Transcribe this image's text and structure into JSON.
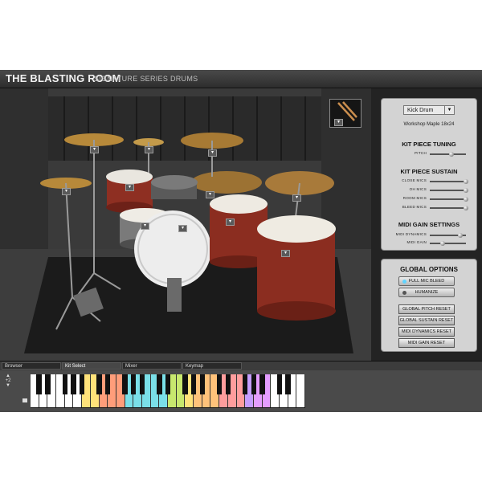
{
  "app": {
    "brand": "THE BLASTING ROOM",
    "subtitle": "SIGNATURE SERIES DRUMS"
  },
  "stage": {
    "thumbnail_icon": "drumsticks-icon",
    "drum_buttons_icon": "dropdown-arrow-icon"
  },
  "kit_piece": {
    "selected": "Kick Drum",
    "name": "Workshop Maple 18x24"
  },
  "sections": {
    "tuning_title": "KIT PIECE TUNING",
    "pitch_label": "PITCH",
    "pitch_level": 0.6,
    "sustain_title": "KIT PIECE SUSTAIN",
    "sustain_rows": [
      {
        "label": "CLOSE MICS",
        "level": 1.0
      },
      {
        "label": "OH MICS",
        "level": 1.0
      },
      {
        "label": "ROOM MICS",
        "level": 1.0
      },
      {
        "label": "BLEED MICS",
        "level": 1.0
      }
    ],
    "midi_title": "MIDI GAIN SETTINGS",
    "midi_rows": [
      {
        "label": "MIDI DYNAMICS",
        "level": 0.85
      },
      {
        "label": "MIDI GAIN",
        "level": 0.35
      }
    ]
  },
  "global": {
    "title": "GLOBAL OPTIONS",
    "full_mic_bleed": "FULL MIC BLEED",
    "full_mic_bleed_led": "#5fd4ff",
    "humanize": "HUMANIZE",
    "humanize_led": "#555555",
    "buttons": [
      "GLOBAL PITCH RESET",
      "GLOBAL SUSTAIN RESET",
      "MIDI DYNAMICS RESET",
      "MIDI GAIN RESET"
    ]
  },
  "tabs": [
    {
      "label": "Browser",
      "active": false
    },
    {
      "label": "Kit Select",
      "active": true
    },
    {
      "label": "Mixer",
      "active": false
    },
    {
      "label": "Keymap",
      "active": false
    }
  ],
  "keyboard": {
    "octave_up_icon": "octave-up-icon",
    "octave_value": "+2",
    "octave_down_icon": "octave-down-icon",
    "key_colors": [
      "#ffffff",
      "#ffffff",
      "#ffffff",
      "#ffffff",
      "#ffffff",
      "#ffffff",
      "#ffe27a",
      "#ffe27a",
      "#ff9d7a",
      "#ff9d7a",
      "#ff9d7a",
      "#7adfe8",
      "#7adfe8",
      "#7adfe8",
      "#7adfe8",
      "#7adfe8",
      "#c8e86e",
      "#c8e86e",
      "#ffe27a",
      "#ffc27a",
      "#ffc27a",
      "#ffc27a",
      "#ff9d9d",
      "#ff9d9d",
      "#ff9d9d",
      "#c59dff",
      "#e49dff",
      "#e49dff",
      "#ffffff",
      "#ffffff",
      "#ffffff",
      "#ffffff"
    ]
  }
}
